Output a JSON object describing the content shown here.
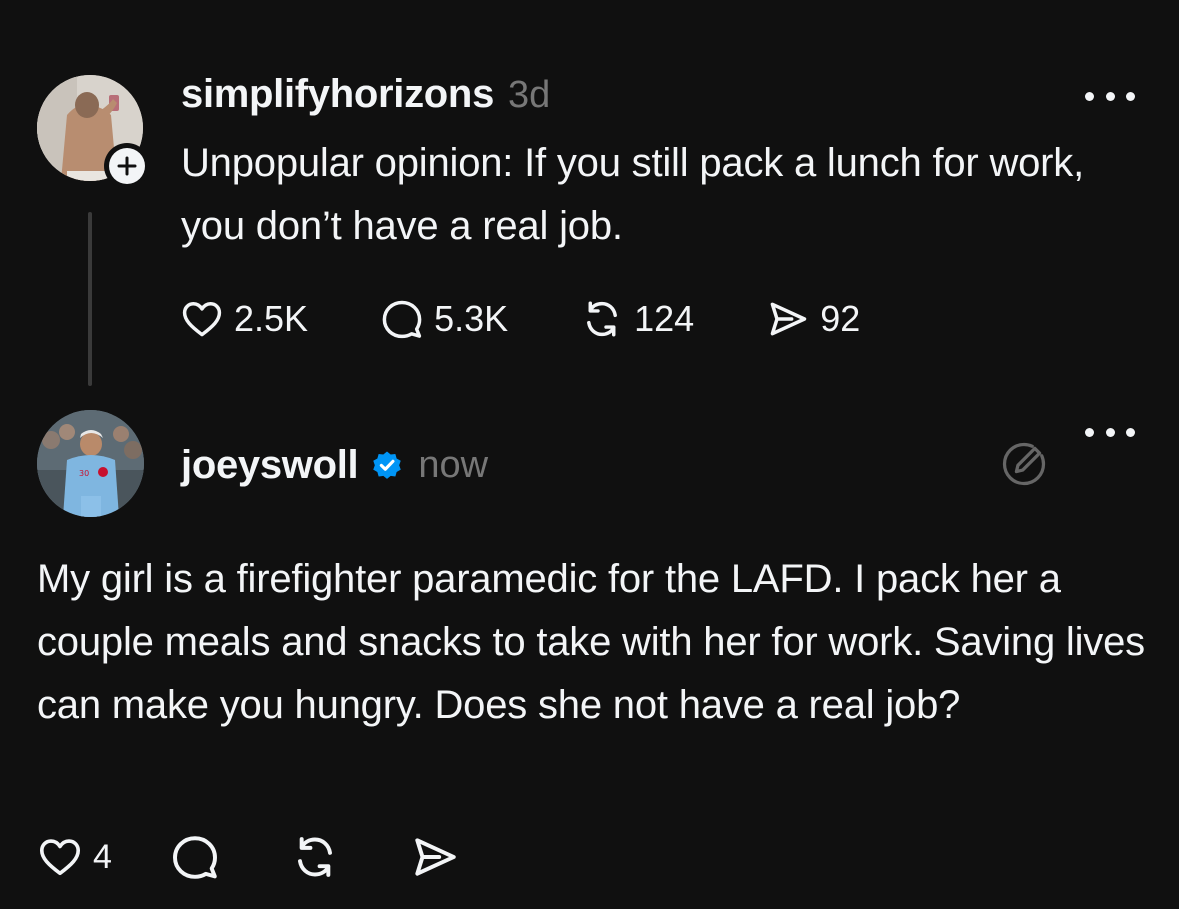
{
  "post1": {
    "username": "simplifyhorizons",
    "time": "3d",
    "text": "Unpopular opinion: If you still pack a lunch for work, you don’t have a real job.",
    "likes": "2.5K",
    "replies": "5.3K",
    "reposts": "124",
    "shares": "92"
  },
  "post2": {
    "username": "joeyswoll",
    "time": "now",
    "text": "My girl is a firefighter paramedic for the LAFD. I pack her a couple meals and snacks to take with her for work. Saving lives can make you hungry. Does she not have a real job?",
    "likes": "4"
  },
  "icons": {
    "follow": "plus-icon",
    "more": "more-dots-icon",
    "like": "heart-icon",
    "reply": "speech-bubble-icon",
    "repost": "repost-icon",
    "share": "send-icon",
    "verified": "verified-badge-icon",
    "edit": "edit-pencil-circle-icon"
  },
  "colors": {
    "background": "#101010",
    "text": "#f3f5f7",
    "muted": "#777777",
    "verified": "#0095f6"
  }
}
